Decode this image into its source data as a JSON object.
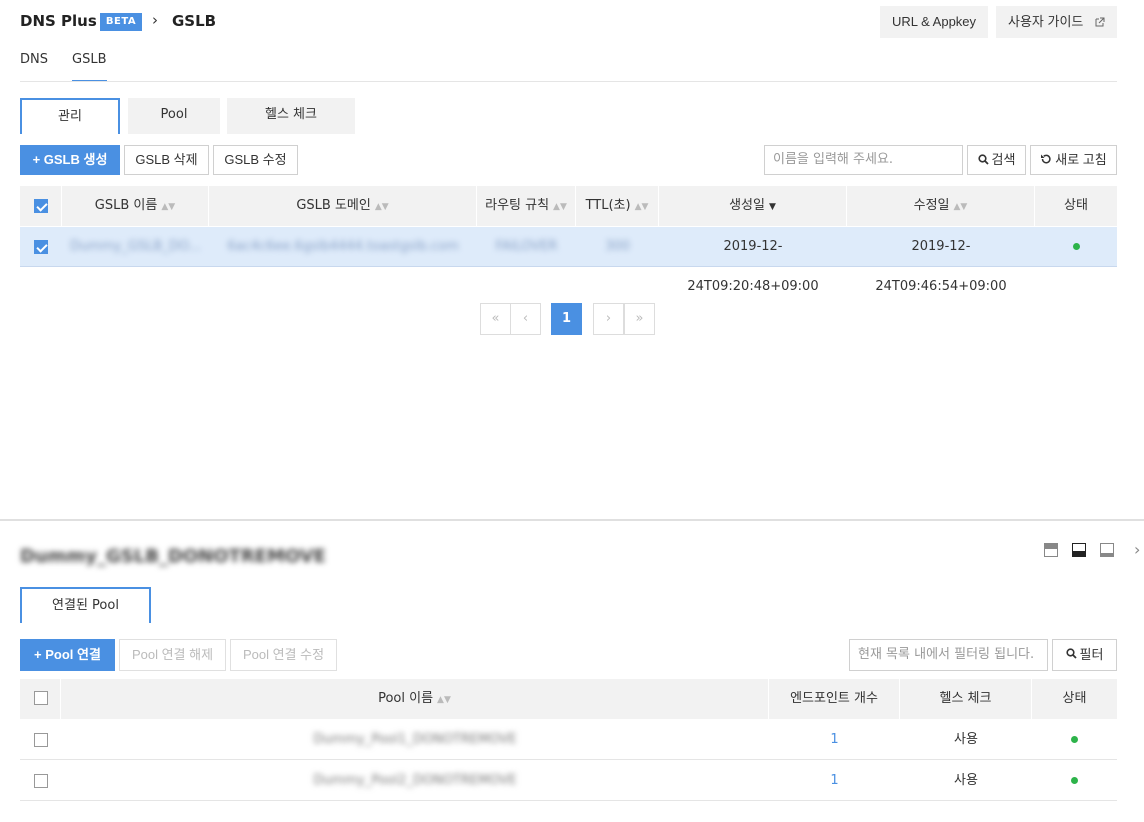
{
  "header": {
    "app_title": "DNS Plus",
    "beta_badge": "BETA",
    "breadcrumb_separator": "›",
    "breadcrumb_current": "GSLB",
    "url_appkey_label": "URL & Appkey",
    "user_guide_label": "사용자 가이드"
  },
  "nav": {
    "dns_label": "DNS",
    "gslb_label": "GSLB"
  },
  "subtabs": {
    "manage": "관리",
    "pool": "Pool",
    "health": "헬스 체크"
  },
  "toolbar": {
    "create_label": "+ GSLB 생성",
    "delete_label": "GSLB 삭제",
    "edit_label": "GSLB 수정",
    "search_placeholder": "이름을 입력해 주세요.",
    "search_label": "검색",
    "refresh_label": "새로 고침"
  },
  "gslb_table": {
    "headers": {
      "name": "GSLB 이름",
      "domain": "GSLB 도메인",
      "routing": "라우팅 규칙",
      "ttl": "TTL(초)",
      "created": "생성일",
      "modified": "수정일",
      "status": "상태"
    },
    "rows": [
      {
        "name": "Dummy_GSLB_DO...",
        "domain": "6ac4c6ee.6gslb4444.toastgslb.com",
        "routing": "FAILOVER",
        "ttl": "300",
        "created": "2019-12-24T09:20:48+09:00",
        "modified": "2019-12-24T09:46:54+09:00",
        "status": "active"
      }
    ]
  },
  "pagination": {
    "first": "«",
    "prev": "‹",
    "current": "1",
    "next": "›",
    "last": "»"
  },
  "detail": {
    "title": "Dummy_GSLB_DONOTREMOVE",
    "tab_label": "연결된 Pool",
    "connect_label": "+ Pool 연결",
    "disconnect_label": "Pool 연결 해제",
    "edit_label": "Pool 연결 수정",
    "filter_placeholder": "현재 목록 내에서 필터링 됩니다.",
    "filter_label": "필터",
    "headers": {
      "pool_name": "Pool 이름",
      "endpoints": "엔드포인트 개수",
      "health": "헬스 체크",
      "status": "상태"
    },
    "rows": [
      {
        "pool_name": "Dummy_Pool1_DONOTREMOVE",
        "endpoints": "1",
        "health": "사용",
        "status": "active"
      },
      {
        "pool_name": "Dummy_Pool2_DONOTREMOVE",
        "endpoints": "1",
        "health": "사용",
        "status": "active"
      }
    ]
  },
  "colors": {
    "accent": "#4a90e2",
    "status_ok": "#2db34a"
  }
}
